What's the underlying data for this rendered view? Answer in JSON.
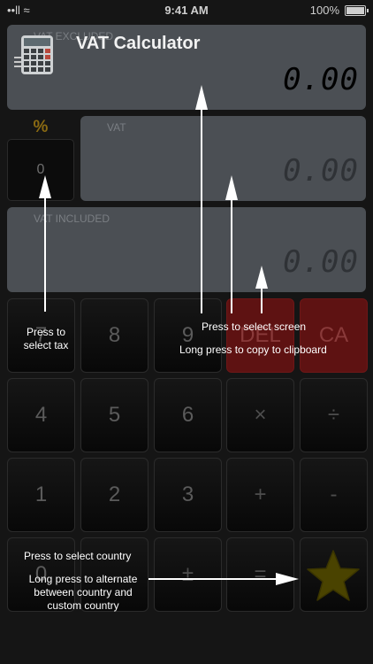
{
  "status_bar": {
    "carrier": "••ll ≈",
    "time": "9:41 AM",
    "battery": "100%"
  },
  "app": {
    "title": "VAT Calculator"
  },
  "displays": {
    "excluded": {
      "label": "VAT EXCLUDED",
      "value": "0.00"
    },
    "vat": {
      "label": "VAT",
      "value": "0.00"
    },
    "included": {
      "label": "VAT INCLUDED",
      "value": "0.00"
    }
  },
  "tax": {
    "symbol": "%",
    "value": "0"
  },
  "keypad": {
    "row1": [
      "7",
      "8",
      "9",
      "DEL",
      "CA"
    ],
    "row2": [
      "4",
      "5",
      "6",
      "×",
      "÷"
    ],
    "row3": [
      "1",
      "2",
      "3",
      "+",
      "-"
    ],
    "row4": [
      "0",
      ".",
      "±",
      "="
    ]
  },
  "annotations": {
    "tax": "Press to select tax",
    "screen": "Press to select screen",
    "long_press": "Long press to copy to clipboard",
    "country": "Press to select country",
    "alternate": "Long press to alternate between country and custom country"
  },
  "colors": {
    "background": "#151515",
    "display": "#4b4f54",
    "accent_red": "#5e1212",
    "star": "#4a4300",
    "tax_symbol": "#8a6a12"
  },
  "icons": {
    "country": "star-icon",
    "menu": "menu-icon",
    "app": "calculator-icon"
  }
}
